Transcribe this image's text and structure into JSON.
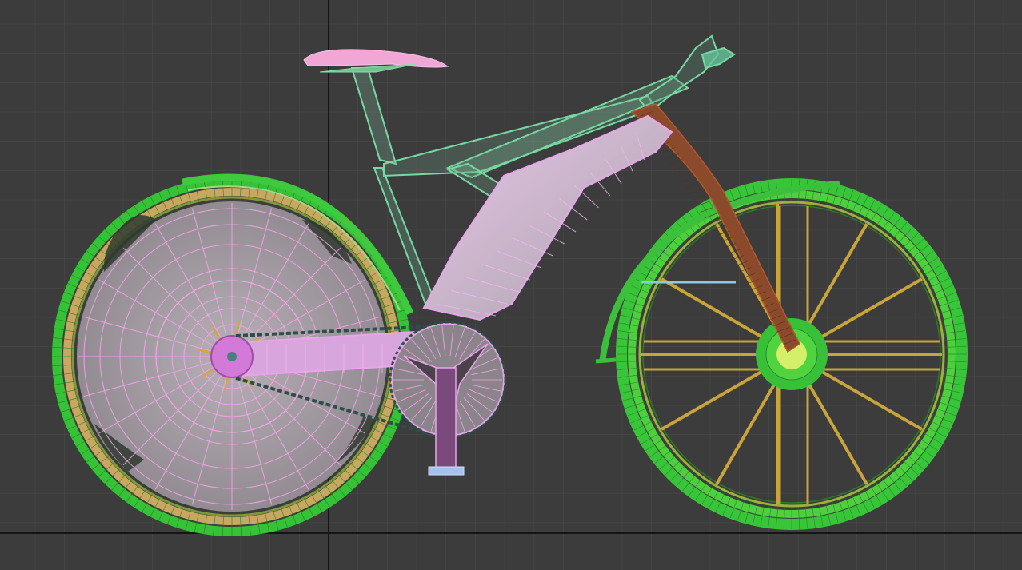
{
  "viewport": {
    "background": "#3c3c3c",
    "grid_color": "#4b4b4b",
    "axis_color": "#151515"
  },
  "model": {
    "colors": {
      "rear_wheel_tire": "#36c236",
      "rear_wheel_rim": "#c8a860",
      "rear_disc": "#a9a1a8",
      "disc_wire": "#f3a6e8",
      "front_tire": "#39c539",
      "front_spokes": "#c9a43a",
      "frame_main": "#e8a6ea",
      "frame_rear": "#78d9a3",
      "fork": "#8a4a2b",
      "saddle": "#f0a7d6",
      "chain": "#2f4d4a",
      "hub_front": "#d4f06a",
      "pedal": "#a5c2ee",
      "reflector_line": "#7fcfe0"
    }
  }
}
